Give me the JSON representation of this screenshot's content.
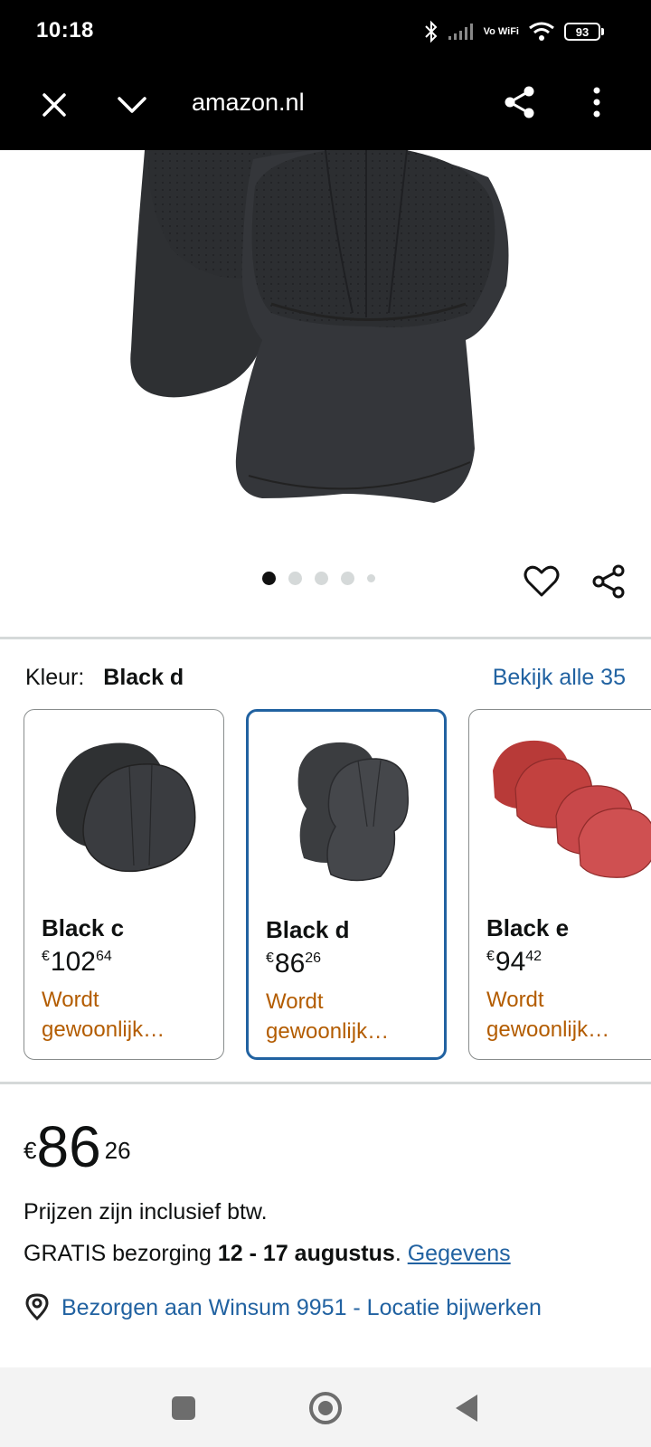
{
  "status_bar": {
    "time": "10:18",
    "network_label": "Vo WiFi",
    "battery": "93",
    "icons": [
      "bluetooth-icon",
      "signal-icon",
      "wifi-icon",
      "battery-icon"
    ]
  },
  "browser": {
    "url": "amazon.nl",
    "icons": [
      "close-icon",
      "chevron-down-icon",
      "share-icon",
      "more-vert-icon"
    ]
  },
  "carousel": {
    "image_count": 5,
    "active_index": 0
  },
  "color_selector": {
    "label": "Kleur:",
    "selected": "Black d",
    "see_all": "Bekijk alle 35",
    "swatches": [
      {
        "name": "Black c",
        "currency": "€",
        "price_whole": "102",
        "price_fraction": "64",
        "status": "Wordt gewoonlijk…",
        "color": "#2f3133",
        "selected": false
      },
      {
        "name": "Black d",
        "currency": "€",
        "price_whole": "86",
        "price_fraction": "26",
        "status": "Wordt gewoonlijk…",
        "color": "#3b3d40",
        "selected": true
      },
      {
        "name": "Black e",
        "currency": "€",
        "price_whole": "94",
        "price_fraction": "42",
        "status": "Wordt gewoonlijk…",
        "color": "#c2413f",
        "selected": false
      }
    ]
  },
  "price": {
    "currency": "€",
    "whole": "86",
    "fraction": "26",
    "vat_note": "Prijzen zijn inclusief btw.",
    "delivery_prefix": "GRATIS bezorging ",
    "delivery_dates": "12 - 17 augustus",
    "delivery_suffix": ". ",
    "details_link": "Gegevens"
  },
  "location": {
    "text": "Bezorgen aan Winsum 9951 - Locatie bijwerken"
  },
  "colors": {
    "link": "#2162a1",
    "status_orange": "#b35c00",
    "selected_border": "#2162a1"
  }
}
